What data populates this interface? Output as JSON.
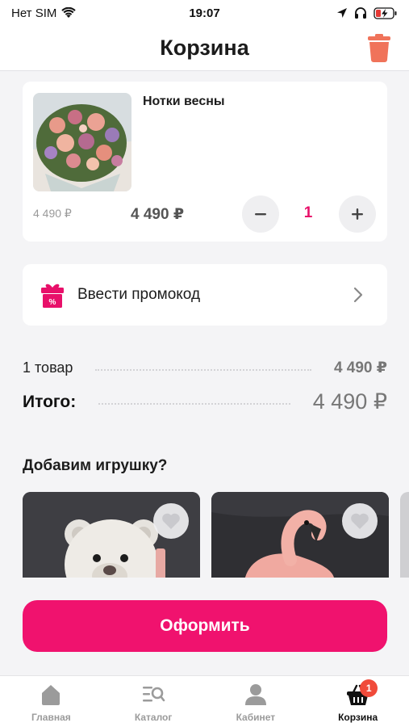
{
  "status_bar": {
    "carrier": "Нет SIM",
    "time": "19:07"
  },
  "header": {
    "title": "Корзина"
  },
  "cart_item": {
    "name": "Нотки весны",
    "old_price": "4 490 ₽",
    "price": "4 490 ₽",
    "quantity": "1"
  },
  "promo": {
    "label": "Ввести промокод"
  },
  "summary": {
    "items_label": "1 товар",
    "items_value": "4 490 ₽",
    "total_label": "Итого:",
    "total_value": "4 490 ₽"
  },
  "toys": {
    "title": "Добавим игрушку?"
  },
  "checkout": {
    "label": "Оформить"
  },
  "tab_bar": {
    "tabs": [
      {
        "label": "Главная",
        "icon": "home-icon"
      },
      {
        "label": "Каталог",
        "icon": "catalog-search-icon"
      },
      {
        "label": "Кабинет",
        "icon": "profile-icon"
      },
      {
        "label": "Корзина",
        "icon": "basket-icon",
        "badge": "1"
      }
    ]
  },
  "colors": {
    "accent": "#f0126e",
    "quantity": "#e8106a",
    "trash": "#f0735a",
    "badge": "#f04a3a"
  }
}
